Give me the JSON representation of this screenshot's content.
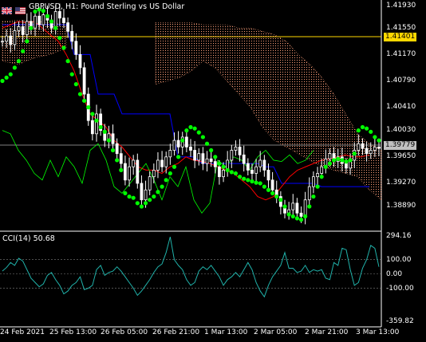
{
  "chart_header": {
    "title": "GBPUSD, H1:  Pound Sterling vs US Dollar",
    "flag_icons": [
      "gb-flag-icon",
      "us-flag-icon"
    ]
  },
  "price_axis": {
    "labels": [
      "1.41930",
      "1.41550",
      "1.41170",
      "1.40790",
      "1.40410",
      "1.40030",
      "1.39650",
      "1.39270",
      "1.38890"
    ]
  },
  "price_markers": {
    "horizontal_line": "1.41401",
    "bid": "1.39779"
  },
  "cci_panel": {
    "title": "CCI(14) 50.68",
    "axis_labels": [
      "294.16",
      "100.00",
      "0.00",
      "-100.00",
      "-359.82"
    ]
  },
  "time_axis": {
    "labels": [
      "24 Feb 2021",
      "25 Feb 13:00",
      "26 Feb 05:00",
      "26 Feb 21:00",
      "1 Mar 13:00",
      "2 Mar 05:00",
      "2 Mar 21:00",
      "3 Mar 13:00"
    ]
  },
  "colors": {
    "background": "#000000",
    "bull_candle": "#ffffff",
    "bear_candle": "#ffffff",
    "parabolic_sar": "#00ff00",
    "tenkan": "#ff0000",
    "kijun": "#0000ff",
    "chikou": "#00ff00",
    "kumo": "#ffa07a",
    "cci_line": "#20b2aa",
    "horizontal_line": "#ffd700",
    "grid_text": "#ffffff"
  },
  "chart_data": {
    "type": "candlestick",
    "symbol": "GBPUSD",
    "timeframe": "H1",
    "title": "GBPUSD, H1:  Pound Sterling vs US Dollar",
    "ylim": [
      1.3855,
      1.42
    ],
    "close": [
      1.414,
      1.4148,
      1.4135,
      1.4156,
      1.4162,
      1.415,
      1.417,
      1.416,
      1.4178,
      1.4165,
      1.418,
      1.4172,
      1.416,
      1.4185,
      1.4175,
      1.4168,
      1.4155,
      1.414,
      1.412,
      1.41,
      1.406,
      1.402,
      1.4,
      1.403,
      1.4005,
      1.399,
      1.4,
      1.3985,
      1.397,
      1.3955,
      1.393,
      1.395,
      1.396,
      1.3925,
      1.39,
      1.3915,
      1.3935,
      1.3945,
      1.396,
      1.395,
      1.3965,
      1.3975,
      1.399,
      1.398,
      1.3995,
      1.398,
      1.3975,
      1.396,
      1.397,
      1.3955,
      1.3962,
      1.3958,
      1.395,
      1.3935,
      1.3945,
      1.396,
      1.3975,
      1.398,
      1.3968,
      1.3955,
      1.3945,
      1.394,
      1.395,
      1.396,
      1.3945,
      1.393,
      1.3915,
      1.3905,
      1.389,
      1.388,
      1.3885,
      1.3895,
      1.388,
      1.3875,
      1.39,
      1.392,
      1.3935,
      1.394,
      1.395,
      1.3962,
      1.397,
      1.3958,
      1.3965,
      1.3955,
      1.3948,
      1.396,
      1.3975,
      1.3985,
      1.3978,
      1.397,
      1.3975,
      1.398,
      1.3978
    ],
    "sar": [
      1.408,
      1.4085,
      1.409,
      1.41,
      1.411,
      1.4125,
      1.414,
      1.416,
      1.4185,
      1.4188,
      1.4186,
      1.4178,
      1.417,
      1.416,
      1.4145,
      1.413,
      1.411,
      1.409,
      1.4075,
      1.406,
      1.405,
      1.404,
      1.403,
      1.402,
      1.401,
      1.4003,
      1.399,
      1.3975,
      1.396,
      1.3945,
      1.391,
      1.3905,
      1.3903,
      1.3895,
      1.389,
      1.3895,
      1.39,
      1.3905,
      1.3912,
      1.392,
      1.393,
      1.394,
      1.395,
      1.3965,
      1.399,
      1.4005,
      1.401,
      1.4008,
      1.4002,
      1.3995,
      1.3985,
      1.3975,
      1.3965,
      1.3955,
      1.395,
      1.3945,
      1.3942,
      1.394,
      1.3935,
      1.3932,
      1.393,
      1.3928,
      1.3926,
      1.3925,
      1.392,
      1.3915,
      1.391,
      1.3905,
      1.39,
      1.389,
      1.3878,
      1.3875,
      1.3872,
      1.387,
      1.3875,
      1.389,
      1.3905,
      1.392,
      1.3935,
      1.395,
      1.3955,
      1.396,
      1.3962,
      1.396,
      1.3958,
      1.396,
      1.397,
      1.4005,
      1.401,
      1.4008,
      1.4003,
      1.3995,
      1.399
    ],
    "cci": [
      20,
      45,
      80,
      60,
      110,
      90,
      30,
      -30,
      -60,
      -90,
      -70,
      -10,
      10,
      -40,
      -80,
      -140,
      -120,
      -80,
      -60,
      -20,
      -110,
      -100,
      -80,
      30,
      60,
      -10,
      10,
      20,
      50,
      20,
      -20,
      -60,
      -100,
      -150,
      -120,
      -80,
      -40,
      10,
      50,
      70,
      150,
      260,
      100,
      60,
      30,
      -40,
      -80,
      -60,
      20,
      50,
      30,
      60,
      20,
      -20,
      -80,
      -40,
      -20,
      10,
      -20,
      30,
      80,
      30,
      -60,
      -120,
      -160,
      -80,
      -20,
      20,
      60,
      150,
      40,
      40,
      10,
      20,
      60,
      10,
      30,
      20,
      30,
      -30,
      -40,
      80,
      60,
      180,
      170,
      30,
      -80,
      -60,
      40,
      100,
      200,
      180,
      50
    ]
  }
}
